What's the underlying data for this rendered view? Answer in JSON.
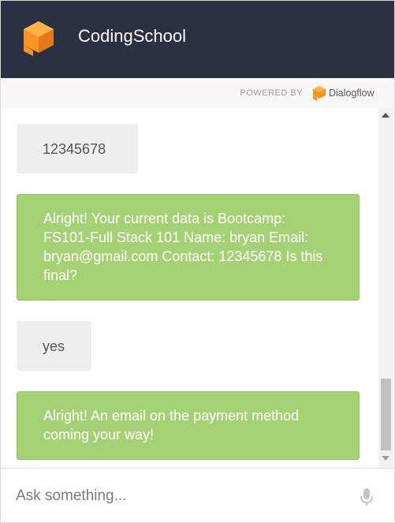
{
  "header": {
    "title": "CodingSchool",
    "logo_icon": "dialogflow-cube-logo",
    "background": "#2a3142"
  },
  "powered_by": {
    "label": "POWERED BY",
    "brand": "Dialogflow",
    "brand_icon": "dialogflow-icon"
  },
  "messages": [
    {
      "sender": "user",
      "text": "12345678"
    },
    {
      "sender": "bot",
      "text": "Alright! Your current data is Bootcamp: FS101-Full Stack 101 Name: bryan Email: bryan@gmail.com Contact: 12345678 Is this final?"
    },
    {
      "sender": "user",
      "text": "yes"
    },
    {
      "sender": "bot",
      "text": "Alright! An email on the payment method coming your way!"
    }
  ],
  "input": {
    "placeholder": "Ask something...",
    "value": "",
    "mic_icon": "microphone-icon"
  },
  "colors": {
    "accent_orange": "#f7931e",
    "bot_bubble": "#a5d175",
    "user_bubble": "#eeeeee"
  }
}
